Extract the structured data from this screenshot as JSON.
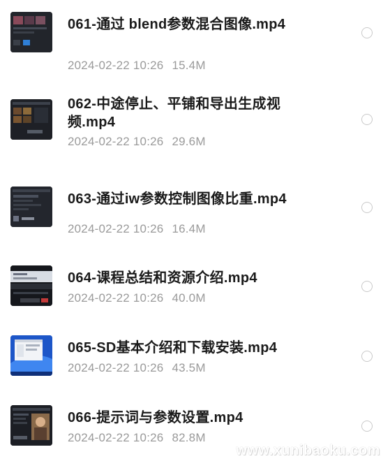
{
  "files": [
    {
      "name": "061-通过 blend参数混合图像.mp4",
      "date": "2024-02-22 10:26",
      "size": "15.4M",
      "thumb_icon": "video-thumbnail-icon"
    },
    {
      "name": "062-中途停止、平铺和导出生成视频.mp4",
      "date": "2024-02-22 10:26",
      "size": "29.6M",
      "thumb_icon": "video-thumbnail-icon"
    },
    {
      "name": "063-通过iw参数控制图像比重.mp4",
      "date": "2024-02-22 10:26",
      "size": "16.4M",
      "thumb_icon": "video-thumbnail-icon"
    },
    {
      "name": "064-课程总结和资源介绍.mp4",
      "date": "2024-02-22 10:26",
      "size": "40.0M",
      "thumb_icon": "video-thumbnail-icon"
    },
    {
      "name": "065-SD基本介绍和下载安装.mp4",
      "date": "2024-02-22 10:26",
      "size": "43.5M",
      "thumb_icon": "video-thumbnail-icon"
    },
    {
      "name": "066-提示词与参数设置.mp4",
      "date": "2024-02-22 10:26",
      "size": "82.8M",
      "thumb_icon": "video-thumbnail-icon"
    }
  ],
  "watermark": "www.xunibaoku.com"
}
